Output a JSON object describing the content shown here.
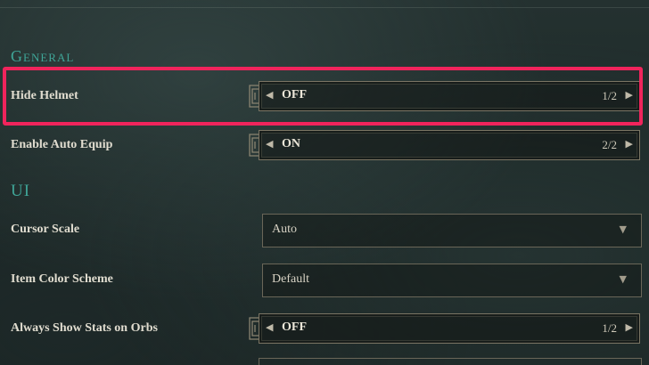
{
  "sections": {
    "general": "General",
    "ui": "UI"
  },
  "settings": {
    "hide_helmet": {
      "label": "Hide Helmet",
      "value": "OFF",
      "page": "1/2"
    },
    "enable_auto_equip": {
      "label": "Enable Auto Equip",
      "value": "ON",
      "page": "2/2"
    },
    "cursor_scale": {
      "label": "Cursor Scale",
      "value": "Auto"
    },
    "item_color_scheme": {
      "label": "Item Color Scheme",
      "value": "Default"
    },
    "always_show_stats": {
      "label": "Always Show Stats on Orbs",
      "value": "OFF",
      "page": "1/2"
    }
  },
  "icons": {
    "arrow_left": "◀",
    "arrow_right": "▶",
    "caret_down": "▼"
  },
  "colors": {
    "section_title": "#3fa597",
    "highlight": "#f0245c"
  }
}
